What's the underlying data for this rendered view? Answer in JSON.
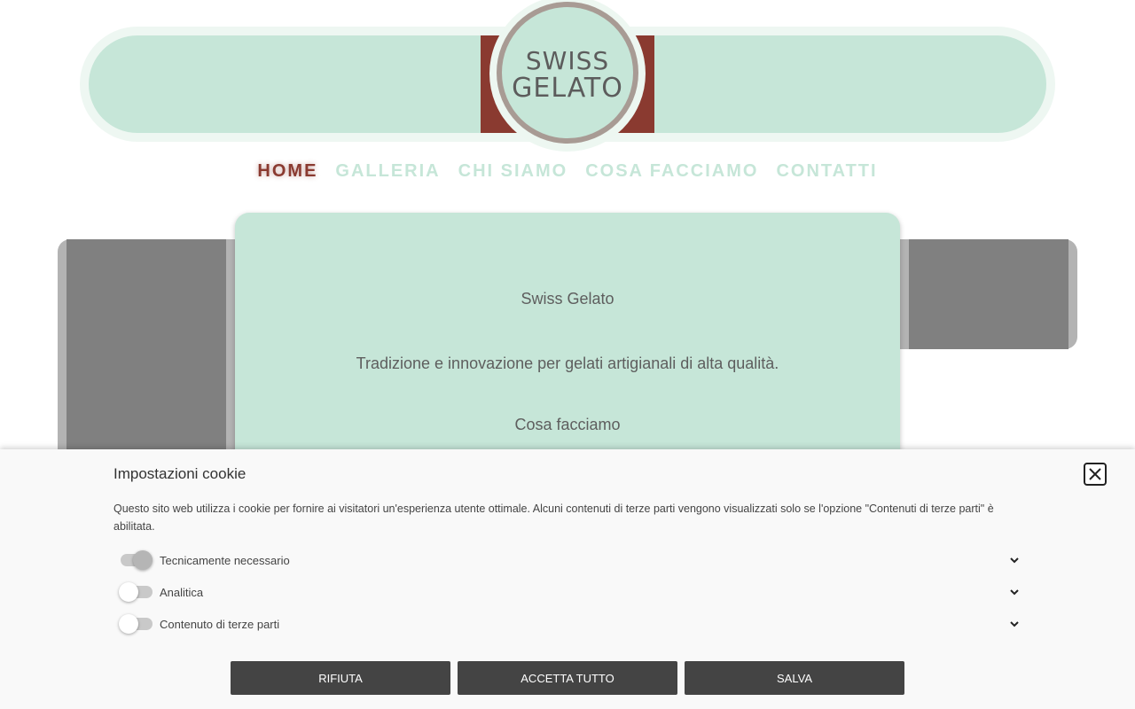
{
  "logo": {
    "line1": "SWISS",
    "line2": "GELATO"
  },
  "nav": {
    "items": [
      {
        "label": "HOME",
        "active": true
      },
      {
        "label": "GALLERIA",
        "active": false
      },
      {
        "label": "CHI SIAMO",
        "active": false
      },
      {
        "label": "COSA FACCIAMO",
        "active": false
      },
      {
        "label": "CONTATTI",
        "active": false
      }
    ]
  },
  "content": {
    "title": "Swiss Gelato",
    "tagline": "Tradizione e innovazione per gelati artigianali di alta qualità.",
    "section": "Cosa facciamo"
  },
  "cookie": {
    "title": "Impostazioni cookie",
    "description": "Questo sito web utilizza i cookie per fornire ai visitatori un'esperienza utente ottimale. Alcuni contenuti di terze parti vengono visualizzati solo se l'opzione \"Contenuti di terze parti\" è abilitata.",
    "options": [
      {
        "label": "Tecnicamente necessario",
        "enabled": true
      },
      {
        "label": "Analitica",
        "enabled": false
      },
      {
        "label": "Contenuto di terze parti",
        "enabled": false
      }
    ],
    "buttons": {
      "reject": "RIFIUTA",
      "accept_all": "ACCETTA TUTTO",
      "save": "SALVA"
    }
  },
  "colors": {
    "mint": "#c6e6d8",
    "brand_red": "#8a3a30",
    "button_dark": "#444444"
  }
}
